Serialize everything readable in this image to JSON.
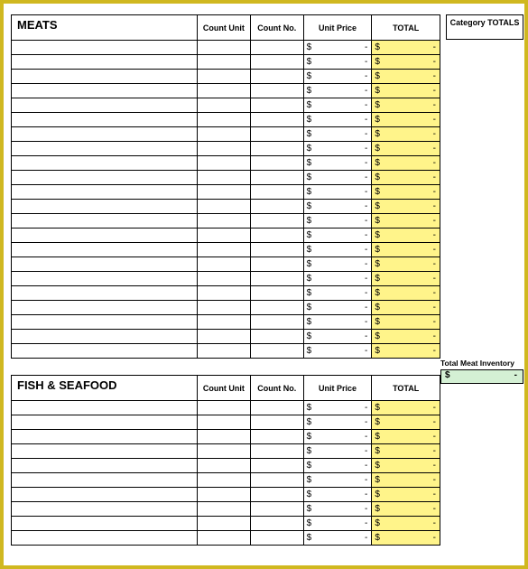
{
  "headers": {
    "count_unit": "Count Unit",
    "count_no": "Count No.",
    "unit_price": "Unit Price",
    "total": "TOTAL",
    "category_totals": "Category TOTALS"
  },
  "sections": [
    {
      "title": "MEATS",
      "rows": 22,
      "summary_label": "Total Meat Inventory",
      "summary_value": "-",
      "summary_sym": "$"
    },
    {
      "title": "FISH & SEAFOOD",
      "rows": 10
    }
  ],
  "money": {
    "sym": "$",
    "dash": "-"
  }
}
